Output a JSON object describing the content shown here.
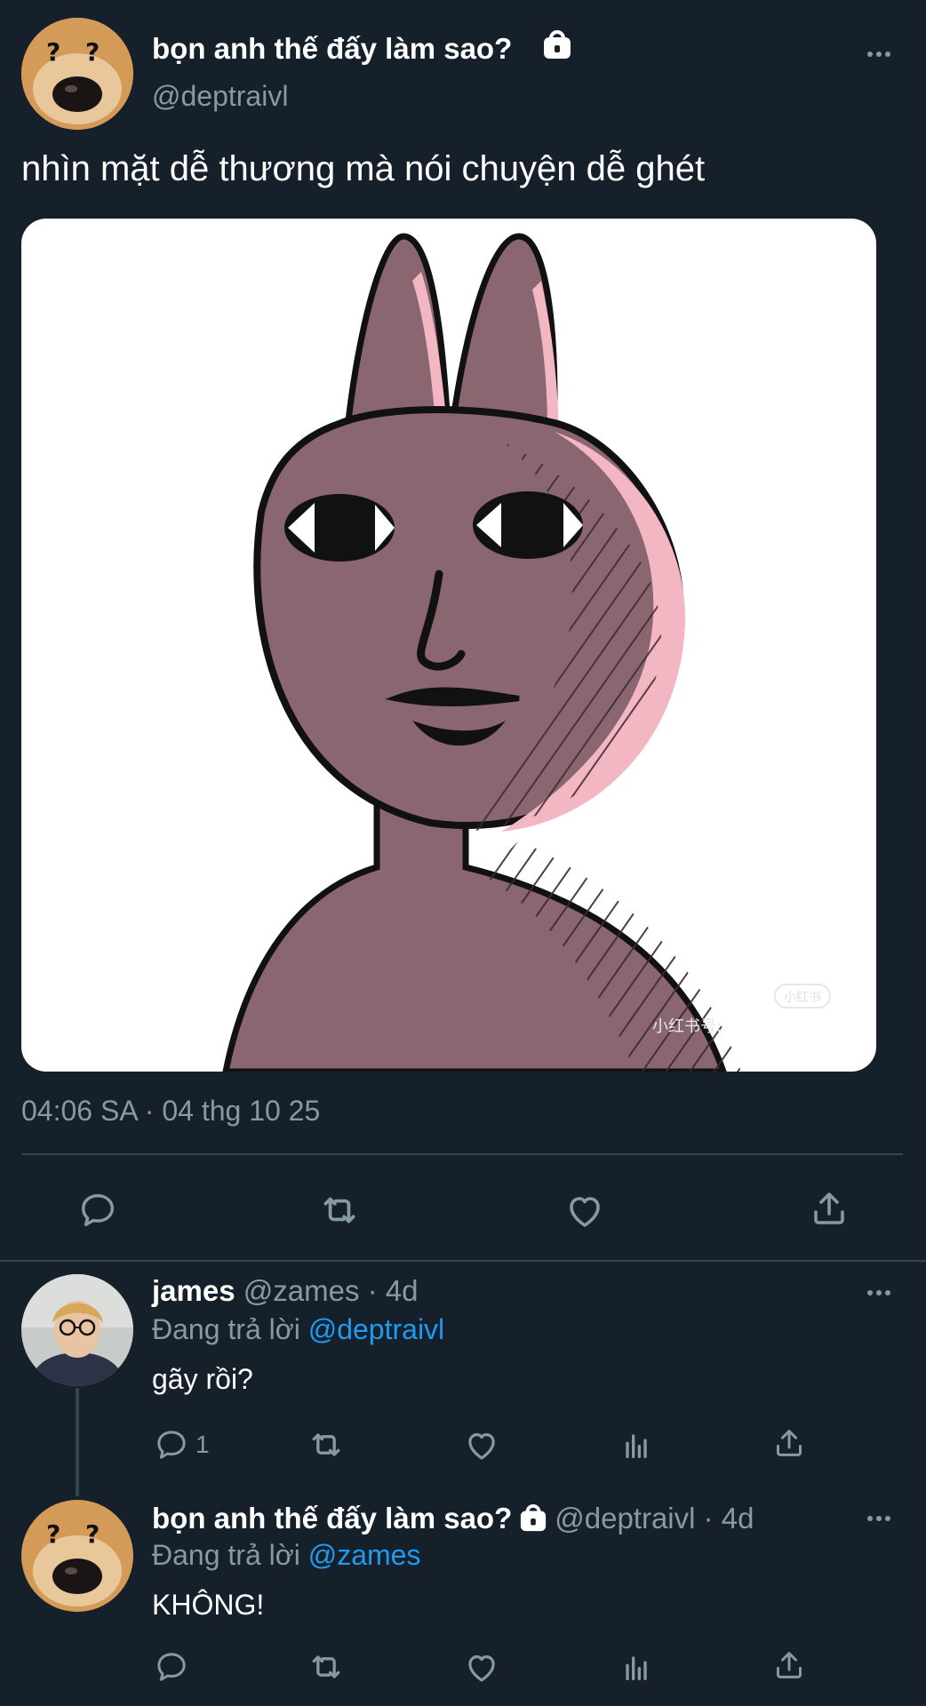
{
  "colors": {
    "background": "#15202b",
    "text": "#ffffff",
    "muted": "#8899a6",
    "link": "#1d9bf0",
    "divider": "#38444d",
    "bunny": "#8a6670",
    "bunny_highlight": "#f3b6c3"
  },
  "main_tweet": {
    "display_name": "bọn anh thế đấy làm sao?",
    "handle": "@deptraivl",
    "text": "nhìn mặt dễ thương mà nói chuyện dễ ghét",
    "image_watermark": "小红书号:",
    "image_watermark_badge": "小红书",
    "timestamp": "04:06 SA · 04 thg 10 25",
    "actions": [
      "reply-icon",
      "retweet-icon",
      "like-icon",
      "share-icon"
    ]
  },
  "replies": [
    {
      "display_name": "james",
      "meta": "@zames · 4d",
      "replying_prefix": "Đang trả lời",
      "replying_to": "@deptraivl",
      "text": "gãy rồi?",
      "reply_count": "1"
    },
    {
      "display_name": "bọn anh thế đấy làm sao?",
      "meta": "@deptraivl · 4d",
      "replying_prefix": "Đang trả lời",
      "replying_to": "@zames",
      "text": "KHÔNG!"
    }
  ]
}
